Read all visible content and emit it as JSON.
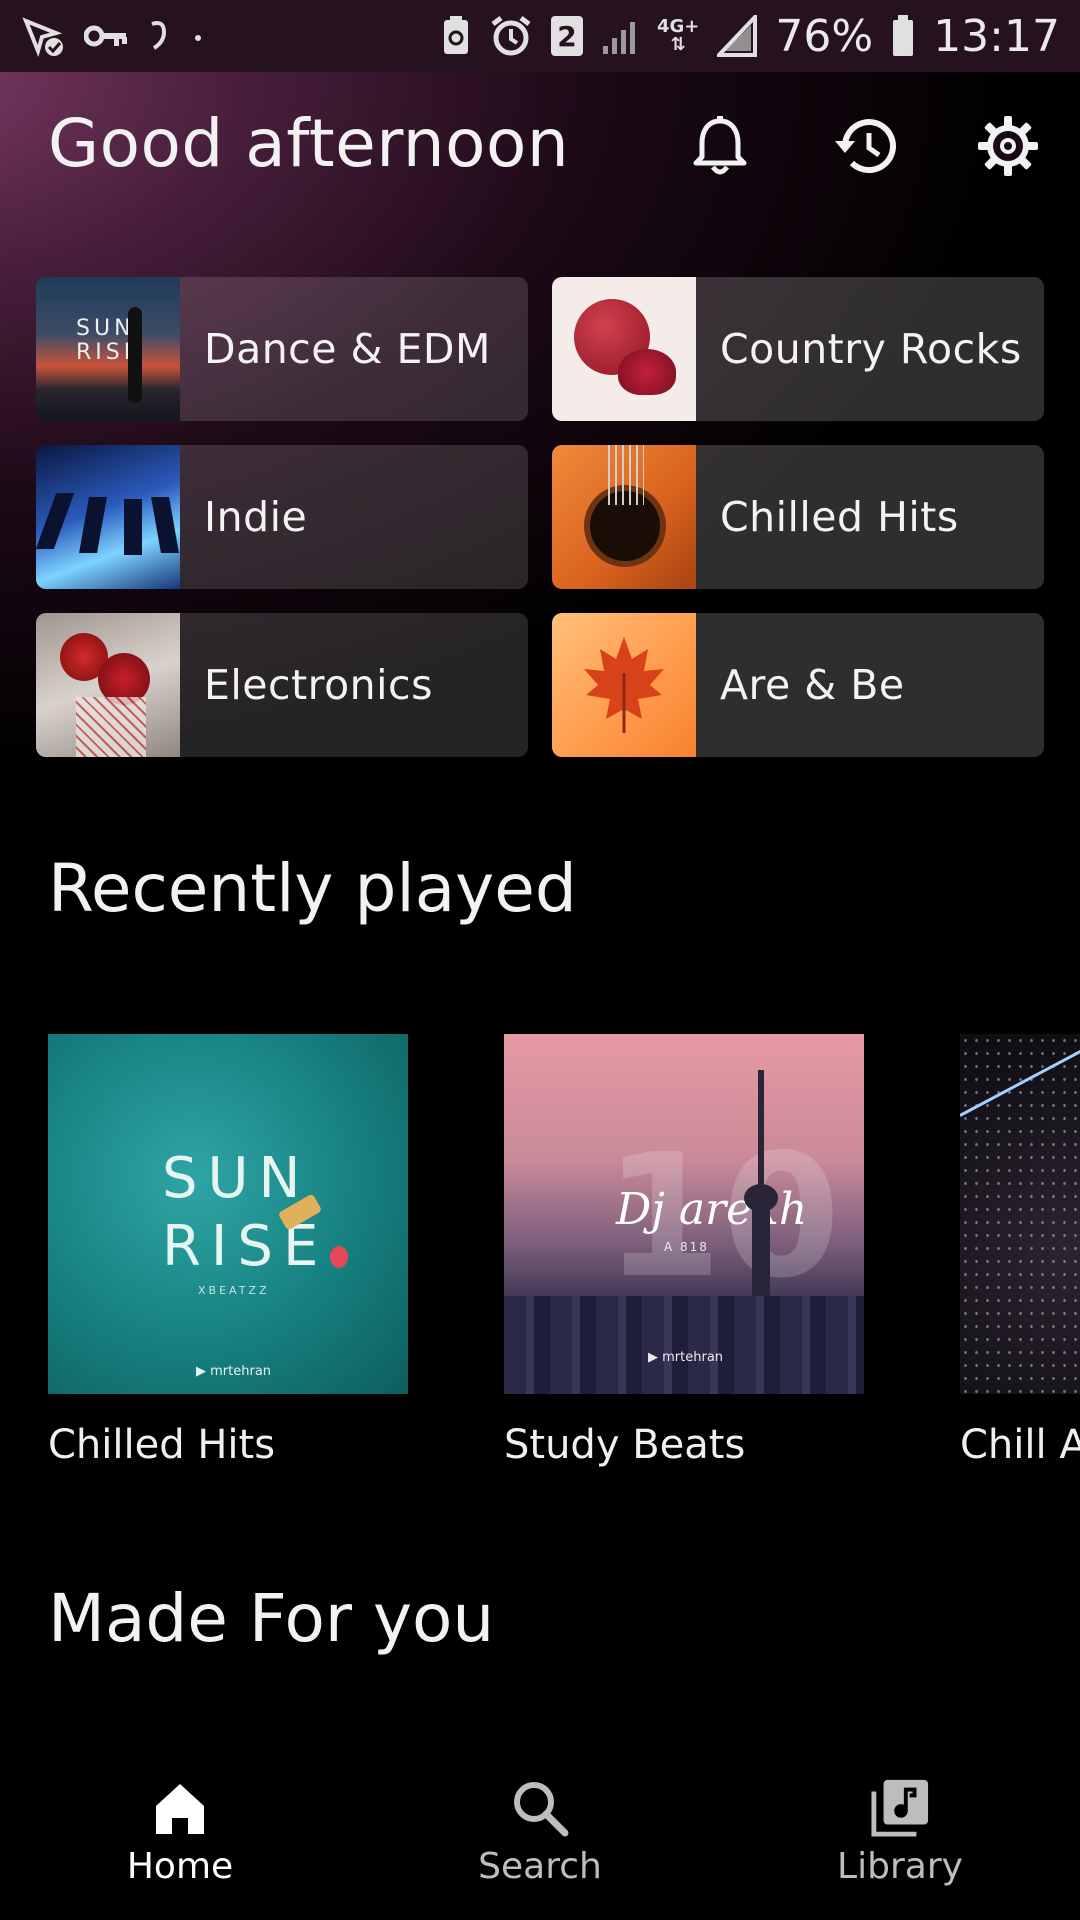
{
  "status_bar": {
    "left_icons": [
      "bluetooth-check-icon",
      "key-icon",
      "sync-icon",
      "dot-icon"
    ],
    "right_icons": [
      "recycle-icon",
      "alarm-icon",
      "sim2-icon",
      "signal-icon",
      "4g-icon",
      "signal-full-icon",
      "battery-icon"
    ],
    "sim_badge": "2",
    "network": "4G+",
    "battery": "76%",
    "time": "13:17"
  },
  "header": {
    "greeting": "Good afternoon",
    "icons": [
      "bell-icon",
      "history-icon",
      "gear-icon"
    ]
  },
  "quick_picks": [
    {
      "label": "Dance & EDM",
      "thumb": "sunrise-surfer-thumb"
    },
    {
      "label": "Country Rocks",
      "thumb": "pomegranate-thumb"
    },
    {
      "label": "Indie",
      "thumb": "piano-keys-thumb"
    },
    {
      "label": "Chilled Hits",
      "thumb": "guitar-thumb"
    },
    {
      "label": "Electronics",
      "thumb": "roses-thumb"
    },
    {
      "label": "Are & Be",
      "thumb": "maple-leaf-thumb"
    }
  ],
  "recently_played": {
    "title": "Recently played",
    "items": [
      {
        "caption": "Chilled Hits",
        "art_text_1": "SUN",
        "art_text_2": "RISE",
        "art_small": "XBEATZZ",
        "art_brand": "mrtehran"
      },
      {
        "caption": "Study Beats",
        "art_text_1": "Dj arekh",
        "art_text_2": "A 818",
        "art_big": "10",
        "art_brand": "mrtehran"
      },
      {
        "caption": "Chill A"
      }
    ]
  },
  "made_for_you": {
    "title": "Made For you"
  },
  "bottom_nav": {
    "items": [
      {
        "label": "Home",
        "icon": "home-icon",
        "active": true
      },
      {
        "label": "Search",
        "icon": "search-icon",
        "active": false
      },
      {
        "label": "Library",
        "icon": "library-icon",
        "active": false
      }
    ]
  },
  "colors": {
    "accent_gradient": "#7a3a62",
    "background": "#000000",
    "tile_bg": "#3b3b3b"
  }
}
